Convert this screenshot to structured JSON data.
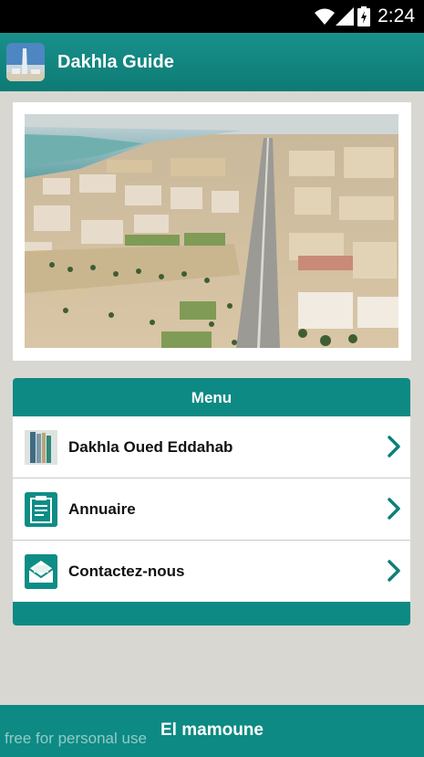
{
  "status_bar": {
    "time": "2:24",
    "icons": [
      "wifi-icon",
      "signal-icon",
      "battery-icon"
    ]
  },
  "app_bar": {
    "title": "Dakhla Guide",
    "icon": "app-logo-icon"
  },
  "hero": {
    "image": "aerial-city-photo"
  },
  "menu": {
    "title": "Menu",
    "items": [
      {
        "label": "Dakhla Oued Eddahab",
        "icon": "book-stack-icon"
      },
      {
        "label": "Annuaire",
        "icon": "clipboard-icon"
      },
      {
        "label": "Contactez-nous",
        "icon": "envelope-icon"
      }
    ]
  },
  "footer": {
    "title": "El mamoune",
    "watermark": "free for personal use"
  },
  "colors": {
    "primary": "#0d8a83",
    "background": "#d8d7d2",
    "status_bar": "#000000"
  }
}
